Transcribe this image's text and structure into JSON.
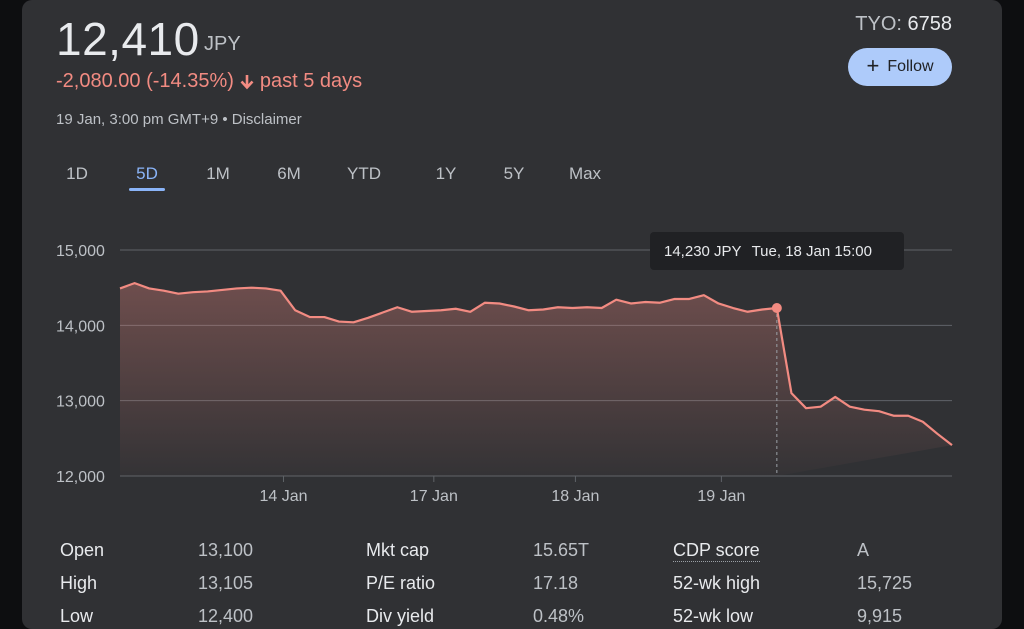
{
  "quote": {
    "price": "12,410",
    "currency": "JPY",
    "change": "-2,080.00 (-14.35%)",
    "change_period": "past 5 days",
    "timestamp": "19 Jan, 3:00 pm GMT+9 • Disclaimer",
    "exchange_label": "TYO: ",
    "ticker": "6758"
  },
  "follow_button": {
    "label": "Follow"
  },
  "tabs": [
    {
      "label": "1D"
    },
    {
      "label": "5D",
      "active": true
    },
    {
      "label": "1M"
    },
    {
      "label": "6M"
    },
    {
      "label": "YTD"
    },
    {
      "label": "1Y"
    },
    {
      "label": "5Y"
    },
    {
      "label": "Max"
    }
  ],
  "tooltip": {
    "price": "14,230 JPY",
    "date": "Tue, 18 Jan 15:00"
  },
  "colors": {
    "line": "#f28b82",
    "accent": "#8ab4f8",
    "follow_bg": "#aecbfa",
    "card_bg": "#303134"
  },
  "chart_data": {
    "type": "area",
    "ylim": [
      12000,
      15000
    ],
    "yticks": [
      "15,000",
      "14,000",
      "13,000",
      "12,000"
    ],
    "ytick_values": [
      15000,
      14000,
      13000,
      12000
    ],
    "xtick_labels": [
      "14 Jan",
      "17 Jan",
      "18 Jan",
      "19 Jan"
    ],
    "xtick_index": [
      11.2,
      21.5,
      31.2,
      41.2
    ],
    "values": [
      14490,
      14560,
      14490,
      14460,
      14420,
      14440,
      14450,
      14470,
      14490,
      14500,
      14490,
      14460,
      14200,
      14110,
      14110,
      14050,
      14040,
      14100,
      14170,
      14240,
      14180,
      14190,
      14200,
      14220,
      14180,
      14300,
      14290,
      14250,
      14200,
      14210,
      14240,
      14230,
      14240,
      14230,
      14340,
      14290,
      14310,
      14300,
      14350,
      14350,
      14400,
      14290,
      14230,
      14180,
      14210,
      14230,
      13100,
      12900,
      12920,
      13050,
      12920,
      12880,
      12860,
      12800,
      12800,
      12720,
      12560,
      12410
    ],
    "highlight_index": 45,
    "grid": true
  },
  "stats": [
    [
      {
        "label": "Open",
        "value": "13,100"
      },
      {
        "label": "High",
        "value": "13,105"
      },
      {
        "label": "Low",
        "value": "12,400"
      }
    ],
    [
      {
        "label": "Mkt cap",
        "value": "15.65T"
      },
      {
        "label": "P/E ratio",
        "value": "17.18"
      },
      {
        "label": "Div yield",
        "value": "0.48%"
      }
    ],
    [
      {
        "label": "CDP score",
        "value": "A"
      },
      {
        "label": "52-wk high",
        "value": "15,725"
      },
      {
        "label": "52-wk low",
        "value": "9,915"
      }
    ]
  ]
}
